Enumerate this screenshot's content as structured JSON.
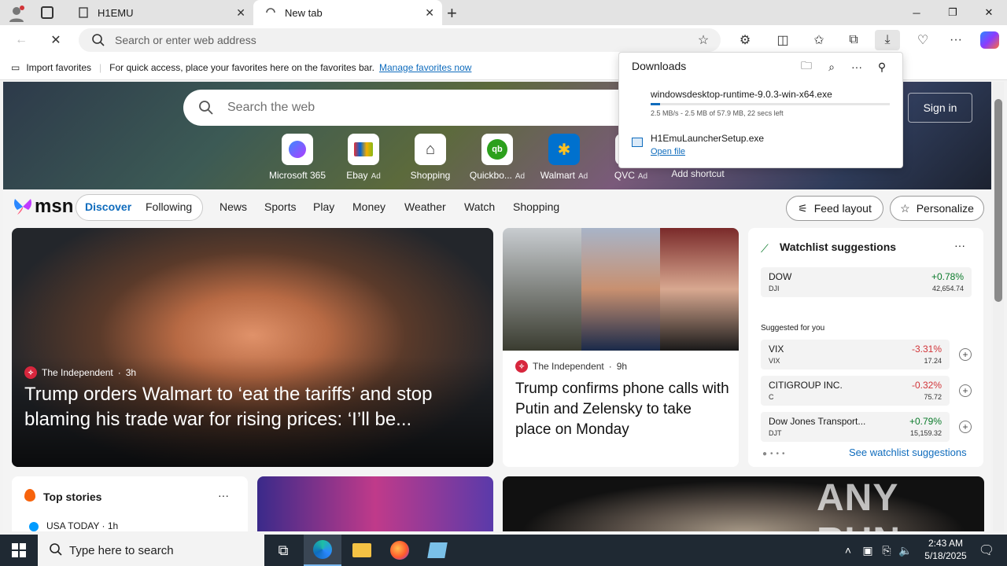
{
  "browser": {
    "tabs": [
      {
        "label": "H1EMU",
        "active": false
      },
      {
        "label": "New tab",
        "active": true
      }
    ],
    "address_placeholder": "Search or enter web address",
    "favorites_bar": {
      "import_label": "Import favorites",
      "hint": "For quick access, place your favorites here on the favorites bar.",
      "manage_link": "Manage favorites now"
    }
  },
  "downloads": {
    "title": "Downloads",
    "items": [
      {
        "file": "windowsdesktop-runtime-9.0.3-win-x64.exe",
        "status": "2.5 MB/s - 2.5 MB of 57.9 MB, 22 secs left",
        "progress_fraction": 0.04
      },
      {
        "file": "H1EmuLauncherSetup.exe",
        "action": "Open file"
      }
    ]
  },
  "newtab": {
    "search_placeholder": "Search the web",
    "signin": "Sign in",
    "shortcuts": [
      {
        "label": "Microsoft 365",
        "ad": ""
      },
      {
        "label": "Ebay",
        "ad": "Ad"
      },
      {
        "label": "Shopping",
        "ad": ""
      },
      {
        "label": "Quickbo...",
        "ad": "Ad"
      },
      {
        "label": "Walmart",
        "ad": "Ad"
      },
      {
        "label": "QVC",
        "ad": "Ad"
      },
      {
        "label": "Add shortcut",
        "ad": ""
      }
    ]
  },
  "msn": {
    "logo": "msn",
    "tabs": [
      "Discover",
      "Following"
    ],
    "nav": [
      "News",
      "Sports",
      "Play",
      "Money",
      "Weather",
      "Watch",
      "Shopping"
    ],
    "feed_layout": "Feed layout",
    "personalize": "Personalize"
  },
  "cards": {
    "main": {
      "source": "The Independent",
      "age": "3h",
      "headline": "Trump orders Walmart to ‘eat the tariffs’ and stop blaming his trade war for rising prices: ‘I’ll be..."
    },
    "second": {
      "source": "The Independent",
      "age": "9h",
      "headline": "Trump confirms phone calls with Putin and Zelensky to take place on Monday"
    },
    "top_stories": {
      "title": "Top stories",
      "first_source": "USA TODAY",
      "first_age": "1h"
    }
  },
  "watchlist": {
    "title": "Watchlist suggestions",
    "main": {
      "name": "DOW",
      "ticker": "DJI",
      "change": "+0.78%",
      "value": "42,654.74"
    },
    "suggested_label": "Suggested for you",
    "suggested": [
      {
        "name": "VIX",
        "ticker": "VIX",
        "change": "-3.31%",
        "value": "17.24",
        "dir": "down"
      },
      {
        "name": "CITIGROUP INC.",
        "ticker": "C",
        "change": "-0.32%",
        "value": "75.72",
        "dir": "down"
      },
      {
        "name": "Dow Jones Transport...",
        "ticker": "DJT",
        "change": "+0.79%",
        "value": "15,159.32",
        "dir": "up"
      }
    ],
    "see_more": "See watchlist suggestions"
  },
  "taskbar": {
    "search_placeholder": "Type here to search",
    "time": "2:43 AM",
    "date": "5/18/2025"
  },
  "watermark": "ANY RUN",
  "colors": {
    "accent": "#0f6cbd",
    "up": "#0a7a2a",
    "down": "#d13438",
    "taskbar": "#1f2933"
  }
}
